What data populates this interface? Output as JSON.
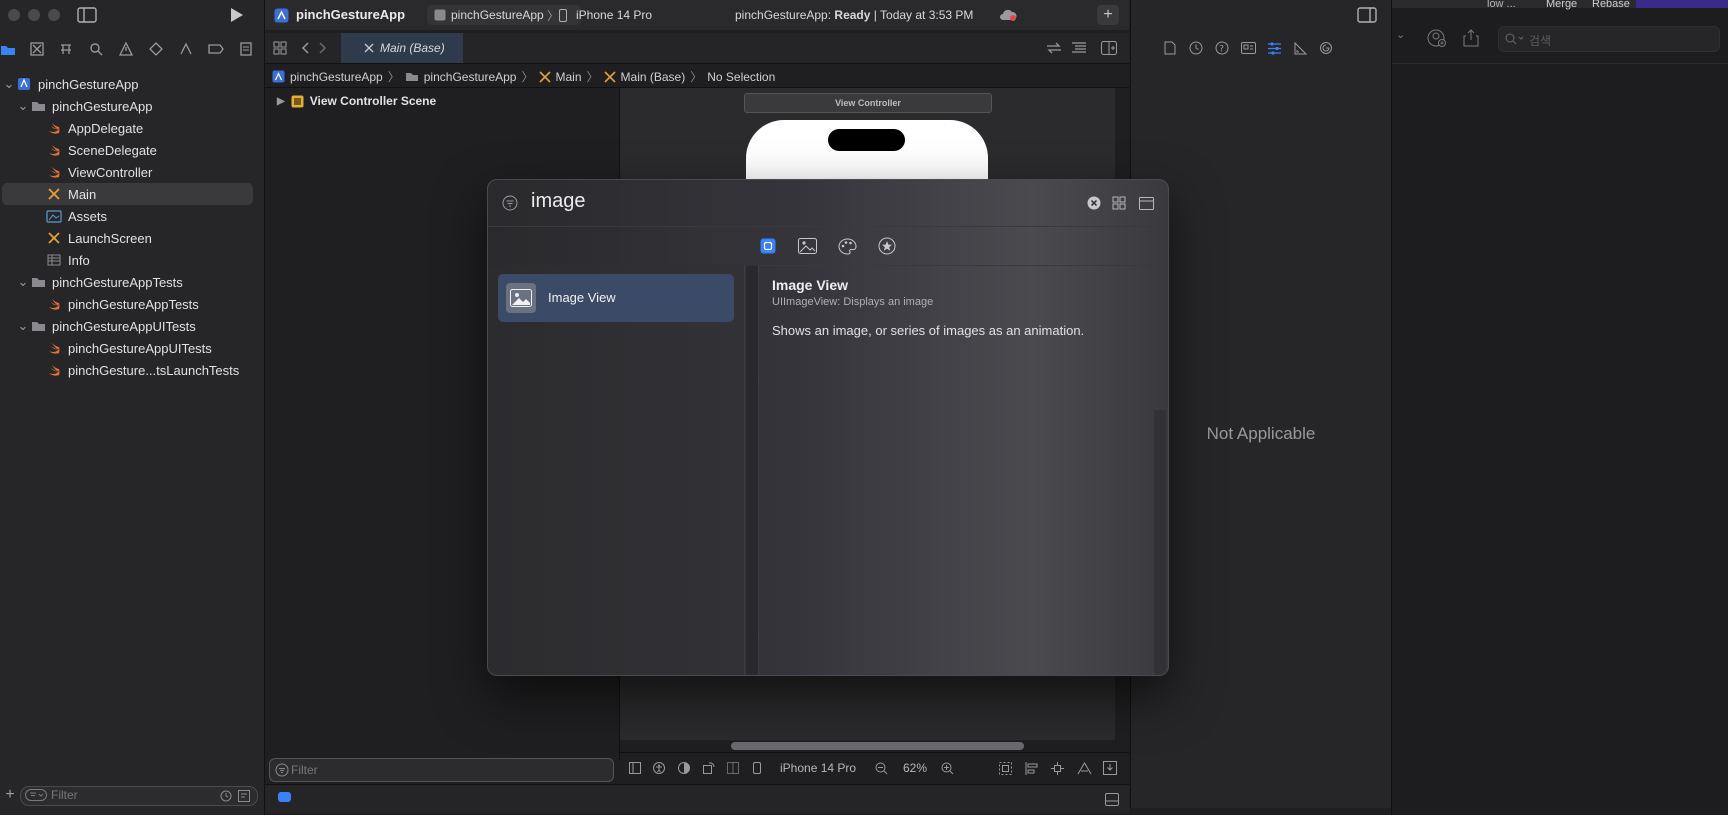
{
  "colors": {
    "accent": "#3b82f6",
    "swift": "#e2733b",
    "folder": "#8a8a8e",
    "ib": "#e0a13a"
  },
  "toolbar": {
    "project_title": "pinchGestureApp",
    "scheme": "pinchGestureApp",
    "device": "iPhone 14 Pro",
    "status_app": "pinchGestureApp:",
    "status_state": "Ready",
    "status_time": "| Today at 3:53 PM"
  },
  "editor_tab": {
    "label": "Main (Base)"
  },
  "jumpbar": {
    "items": [
      "pinchGestureApp",
      "pinchGestureApp",
      "Main",
      "Main (Base)",
      "No Selection"
    ]
  },
  "navigator": {
    "items": [
      {
        "label": "pinchGestureApp",
        "icon": "project-icon"
      },
      {
        "label": "pinchGestureApp",
        "icon": "folder-icon"
      },
      {
        "label": "AppDelegate",
        "icon": "swift-file-icon"
      },
      {
        "label": "SceneDelegate",
        "icon": "swift-file-icon"
      },
      {
        "label": "ViewController",
        "icon": "swift-file-icon"
      },
      {
        "label": "Main",
        "icon": "storyboard-icon"
      },
      {
        "label": "Assets",
        "icon": "asset-catalog-icon"
      },
      {
        "label": "LaunchScreen",
        "icon": "storyboard-icon"
      },
      {
        "label": "Info",
        "icon": "plist-icon"
      },
      {
        "label": "pinchGestureAppTests",
        "icon": "folder-icon"
      },
      {
        "label": "pinchGestureAppTests",
        "icon": "swift-file-icon"
      },
      {
        "label": "pinchGestureAppUITests",
        "icon": "folder-icon"
      },
      {
        "label": "pinchGestureAppUITests",
        "icon": "swift-file-icon"
      },
      {
        "label": "pinchGesture...tsLaunchTests",
        "icon": "swift-file-icon"
      }
    ],
    "filter_placeholder": "Filter"
  },
  "outline": {
    "scene_label": "View Controller Scene",
    "filter_placeholder": "Filter"
  },
  "canvas": {
    "vc_title": "View Controller",
    "device": "iPhone 14 Pro",
    "zoom": "62%"
  },
  "library": {
    "search_value": "image",
    "result_label": "Image View",
    "detail_title": "Image View",
    "detail_subtitle": "UIImageView: Displays an image",
    "detail_description": "Shows an image, or series of images as an animation."
  },
  "inspector": {
    "empty_label": "Not Applicable"
  },
  "right_panel": {
    "search_placeholder": "검색",
    "merge_label": "Merge",
    "rebase_label": "Rebase",
    "truncated_label": "low ..."
  }
}
